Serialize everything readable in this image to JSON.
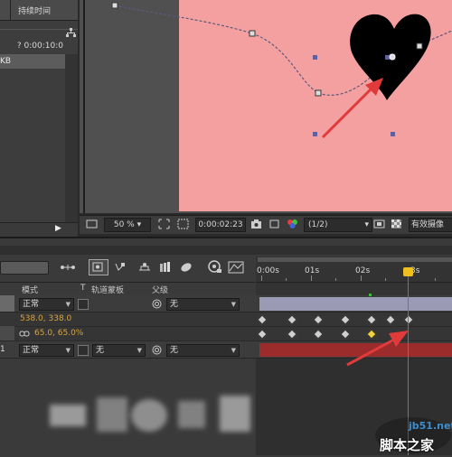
{
  "project_panel": {
    "header_label": "持续时间",
    "duration": "? 0:00:10:0",
    "selected_item_fragment": "KB"
  },
  "viewer_bar": {
    "zoom": "50 %",
    "timecode": "0:00:02:23",
    "resolution": "(1/2)",
    "view_label": "有效摄像"
  },
  "timeline": {
    "ruler_labels": [
      "0:00s",
      "01s",
      "02s",
      "3s"
    ],
    "headers": {
      "mode": "模式",
      "t": "T",
      "track_matte": "轨道蒙板",
      "parent": "父级"
    },
    "layers": [
      {
        "mode": "正常",
        "parent": "无",
        "position_value": "538.0, 338.0",
        "scale_value": "65.0, 65.0%"
      },
      {
        "index": "1",
        "mode": "正常",
        "track_matte": "无",
        "parent": "无"
      }
    ],
    "current_time_fraction_of_ruler": 0.77
  },
  "colors": {
    "canvas": "#f5a0a0",
    "accent_orange": "#d9a43a",
    "current_time_indicator": "#ff3a3a",
    "layer1_bar": "#9a9ab4",
    "layer2_bar": "#9c2c2c",
    "annotation_arrow": "#e03a3a"
  },
  "watermark": {
    "url": "jb51.net",
    "name": "脚本之家"
  },
  "icons": [
    "network-icon",
    "camera-icon",
    "color-channel-icon",
    "keyframe-icon",
    "solo-icon",
    "motion-blur-icon",
    "graph-editor-icon",
    "link-icon",
    "spiral-icon"
  ]
}
